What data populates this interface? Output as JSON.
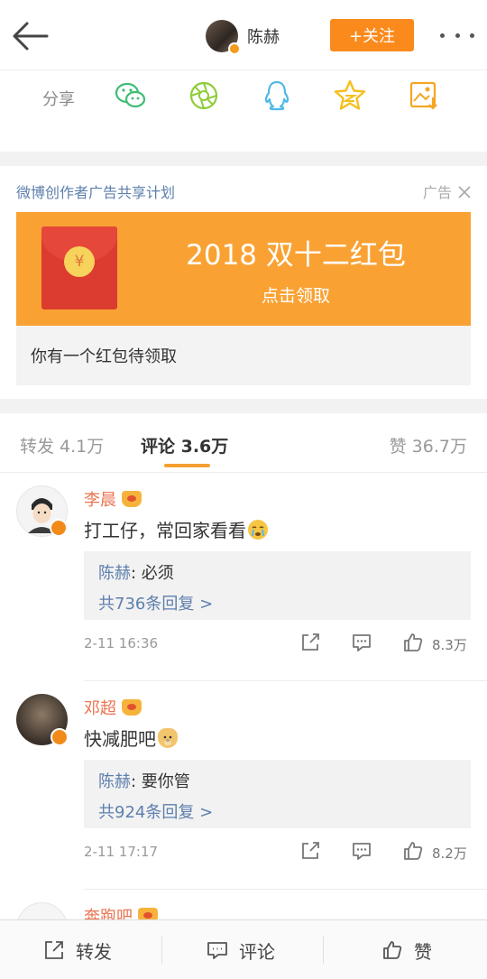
{
  "header": {
    "username": "陈赫",
    "follow_label": "+关注"
  },
  "share": {
    "label": "分享",
    "targets": [
      "wechat-icon",
      "moments-icon",
      "qq-icon",
      "qzone-icon",
      "save-image-icon"
    ]
  },
  "ad": {
    "title": "微博创作者广告共享计划",
    "tag": "广告",
    "banner_main": "2018 双十二红包",
    "banner_sub": "点击领取",
    "coin_symbol": "¥",
    "description": "你有一个红包待领取",
    "banner_color": "#f9a233"
  },
  "tabs": {
    "repost": "转发 4.1万",
    "comment": "评论 3.6万",
    "like": "赞 36.7万"
  },
  "comments": [
    {
      "name": "李晨",
      "text": "打工仔，常回家看看",
      "reply_user": "陈赫",
      "reply_text": ": 必须",
      "reply_more": "共736条回复 >",
      "time": "2-11 16:36",
      "likes": "8.3万"
    },
    {
      "name": "邓超",
      "text": "快减肥吧",
      "reply_user": "陈赫",
      "reply_text": ": 要你管",
      "reply_more": "共924条回复 >",
      "time": "2-11 17:17",
      "likes": "8.2万"
    },
    {
      "name": "奔跑吧"
    }
  ],
  "bottom_bar": {
    "repost": "转发",
    "comment": "评论",
    "like": "赞"
  },
  "colors": {
    "accent": "#fb8a1d",
    "link": "#5d7fad",
    "name": "#eb7350"
  }
}
